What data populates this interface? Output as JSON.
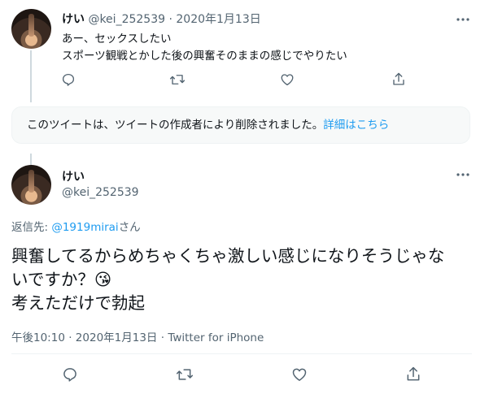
{
  "tweet1": {
    "display_name": "けい",
    "handle": "@kei_252539",
    "sep": "·",
    "date": "2020年1月13日",
    "line1": "あー、セックスしたい",
    "line2": "スポーツ観戦とかした後の興奮そのままの感じでやりたい"
  },
  "notice": {
    "text": "このツイートは、ツイートの作成者により削除されました。",
    "link": "詳細はこちら"
  },
  "tweet2": {
    "display_name": "けい",
    "handle": "@kei_252539",
    "reply_prefix": "返信先: ",
    "reply_to": "@1919mirai",
    "reply_suffix": "さん",
    "body_line1": "興奮してるからめちゃくちゃ激しい感じになりそうじゃな",
    "body_line2": "いですか？😘",
    "body_line3": "考えただけで勃起",
    "time": "午後10:10",
    "sep": "·",
    "date": "2020年1月13日",
    "source": "Twitter for iPhone"
  },
  "icons": {
    "more": "more-horizontal-icon",
    "reply": "reply-icon",
    "retweet": "retweet-icon",
    "like": "like-icon",
    "share": "share-icon"
  },
  "colors": {
    "accent": "#1d9bf0",
    "muted": "#536471",
    "text": "#0f1419"
  }
}
